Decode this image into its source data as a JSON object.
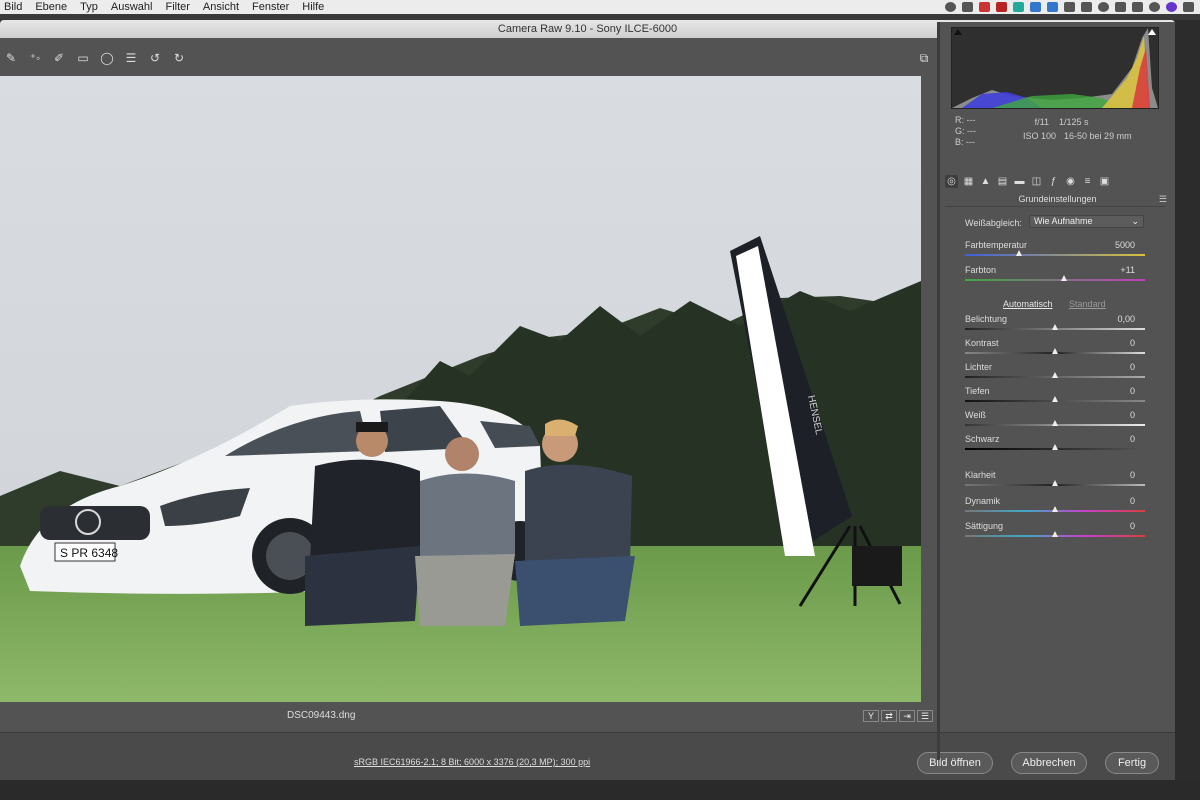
{
  "menubar": {
    "items": [
      "Bild",
      "Ebene",
      "Typ",
      "Auswahl",
      "Filter",
      "Ansicht",
      "Fenster",
      "Hilfe"
    ]
  },
  "window": {
    "title": "Camera Raw 9.10  -  Sony ILCE-6000"
  },
  "filmstrip": {
    "filename": "DSC09443.dng",
    "view_button": "Y"
  },
  "status": {
    "workflow": "sRGB IEC61966-2.1; 8 Bit; 6000 x 3376 (20,3 MP); 300 ppi",
    "open_button": "Bild öffnen",
    "cancel_button": "Abbrechen",
    "done_button": "Fertig"
  },
  "info": {
    "r": "R:  ---",
    "g": "G:  ---",
    "b": "B:  ---",
    "aperture": "f/11",
    "shutter": "1/125 s",
    "iso": "ISO 100",
    "lens": "16-50 bei 29 mm"
  },
  "panel": {
    "title": "Grundeinstellungen",
    "wb_label": "Weißabgleich:",
    "wb_value": "Wie Aufnahme",
    "auto_label": "Automatisch",
    "default_label": "Standard",
    "sliders": [
      {
        "label": "Farbtemperatur",
        "value": "5000",
        "pos": 0.3
      },
      {
        "label": "Farbton",
        "value": "+11",
        "pos": 0.55
      },
      {
        "label": "Belichtung",
        "value": "0,00",
        "pos": 0.5
      },
      {
        "label": "Kontrast",
        "value": "0",
        "pos": 0.5
      },
      {
        "label": "Lichter",
        "value": "0",
        "pos": 0.5
      },
      {
        "label": "Tiefen",
        "value": "0",
        "pos": 0.5
      },
      {
        "label": "Weiß",
        "value": "0",
        "pos": 0.5
      },
      {
        "label": "Schwarz",
        "value": "0",
        "pos": 0.5
      },
      {
        "label": "Klarheit",
        "value": "0",
        "pos": 0.5
      },
      {
        "label": "Dynamik",
        "value": "0",
        "pos": 0.5
      },
      {
        "label": "Sättigung",
        "value": "0",
        "pos": 0.5
      }
    ]
  },
  "photo": {
    "plate": "S PR 6348",
    "softbox_brand": "HENSEL"
  }
}
